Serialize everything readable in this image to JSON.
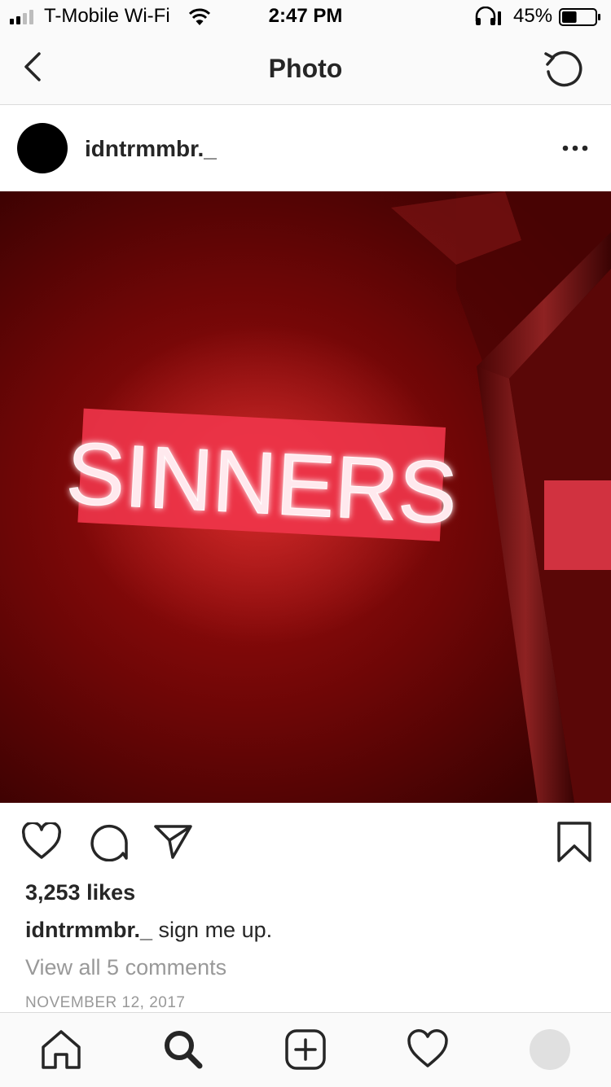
{
  "status_bar": {
    "carrier": "T-Mobile Wi-Fi",
    "time": "2:47 PM",
    "battery_percent": "45%",
    "battery_level": 0.45,
    "icons": [
      "signal-icon",
      "wifi-icon",
      "headphones-icon",
      "battery-icon"
    ]
  },
  "nav": {
    "title": "Photo",
    "icons": [
      "back-chevron-icon",
      "refresh-icon"
    ]
  },
  "post": {
    "username": "idntrmmbr._",
    "photo_sign_text": "SINNERS",
    "likes": "3,253 likes",
    "caption_user": "idntrmmbr._",
    "caption_text": " sign me up.",
    "view_comments": "View all 5 comments",
    "date": "NOVEMBER 12, 2017",
    "icons": [
      "more-options-icon",
      "heart-icon",
      "comment-icon",
      "share-icon",
      "bookmark-icon"
    ]
  },
  "tabbar": {
    "icons": [
      "home-icon",
      "search-icon",
      "new-post-icon",
      "activity-heart-icon",
      "profile-avatar"
    ]
  },
  "colors": {
    "neon": "#ff3b4d",
    "photo_dark": "#3b0202",
    "muted_text": "#999999",
    "text": "#262626"
  }
}
